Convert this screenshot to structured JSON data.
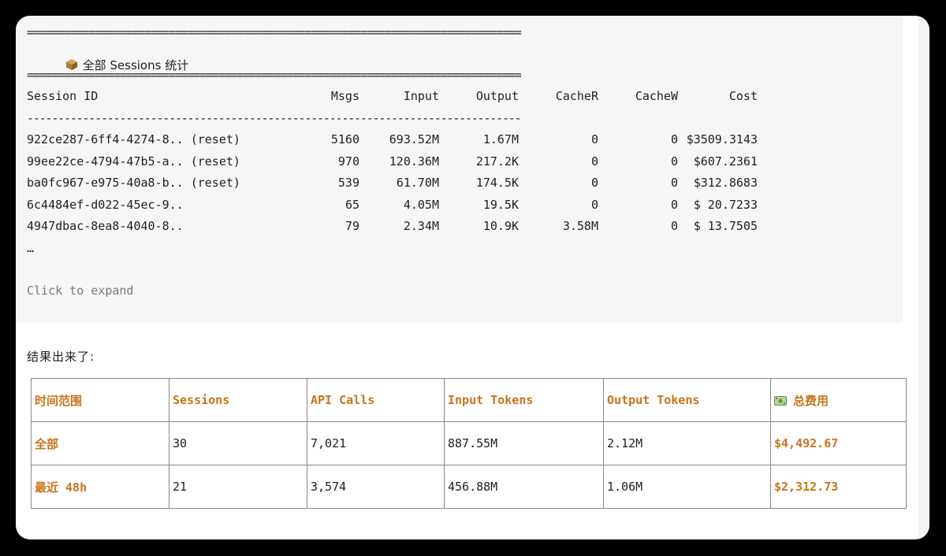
{
  "code_block": {
    "rule": "================================================================================",
    "dash_rule": "--------------------------------------------------------------------------------",
    "title_icon": "package-icon",
    "title": "全部 Sessions 统计",
    "headers": [
      "Session ID",
      "Msgs",
      "Input",
      "Output",
      "CacheR",
      "CacheW",
      "Cost"
    ],
    "rows": [
      {
        "id": "922ce287-6ff4-4274-8.. (reset)",
        "msgs": "5160",
        "input": "693.52M",
        "output": "1.67M",
        "cacher": "0",
        "cachew": "0",
        "cost": "$3509.3143"
      },
      {
        "id": "99ee22ce-4794-47b5-a.. (reset)",
        "msgs": "970",
        "input": "120.36M",
        "output": "217.2K",
        "cacher": "0",
        "cachew": "0",
        "cost": "$607.2361"
      },
      {
        "id": "ba0fc967-e975-40a8-b.. (reset)",
        "msgs": "539",
        "input": "61.70M",
        "output": "174.5K",
        "cacher": "0",
        "cachew": "0",
        "cost": "$312.8683"
      },
      {
        "id": "6c4484ef-d022-45ec-9..",
        "msgs": "65",
        "input": "4.05M",
        "output": "19.5K",
        "cacher": "0",
        "cachew": "0",
        "cost": "$ 20.7233"
      },
      {
        "id": "4947dbac-8ea8-4040-8..",
        "msgs": "79",
        "input": "2.34M",
        "output": "10.9K",
        "cacher": "3.58M",
        "cachew": "0",
        "cost": "$ 13.7505"
      }
    ],
    "ellipsis": "…",
    "expand_label": "Click to expand"
  },
  "result_text": "结果出来了:",
  "summary_table": {
    "money_icon": "money-icon",
    "headers": [
      "时间范围",
      "Sessions",
      "API Calls",
      "Input Tokens",
      "Output Tokens",
      "总费用"
    ],
    "rows": [
      [
        "全部",
        "30",
        "7,021",
        "887.55M",
        "2.12M",
        "$4,492.67"
      ],
      [
        "最近 48h",
        "21",
        "3,574",
        "456.88M",
        "1.06M",
        "$2,312.73"
      ]
    ]
  },
  "colors": {
    "accent": "#c8741b",
    "code_bg": "#f6f6f6",
    "text": "#1f1f1f",
    "muted": "#7a7a7a"
  }
}
